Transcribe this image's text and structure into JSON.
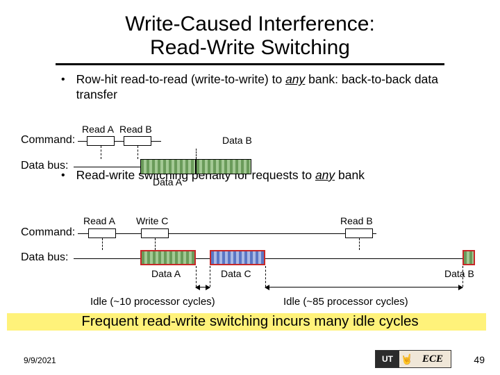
{
  "title_line1": "Write-Caused Interference:",
  "title_line2": "Read-Write Switching",
  "bullets": {
    "b1_pre": "Row-hit read-to-read (write-to-write) to ",
    "b1_em": "any",
    "b1_post": " bank: back-to-back data transfer",
    "b2_pre": "Read-write switching penalty for requests to ",
    "b2_em": "any",
    "b2_post": " bank"
  },
  "labels": {
    "command": "Command:",
    "databus": "Data bus:",
    "read_a": "Read A",
    "read_b": "Read B",
    "write_c": "Write C",
    "data_a": "Data A",
    "data_b": "Data B",
    "data_c": "Data C",
    "idle10": "Idle (~10 processor cycles)",
    "idle85": "Idle (~85 processor cycles)"
  },
  "conclusion": "Frequent read-write switching incurs many idle cycles",
  "footer": {
    "date": "9/9/2021",
    "page": "49",
    "logo_ut": "UT",
    "logo_ece": "ECE"
  },
  "chart_data": [
    {
      "type": "timing",
      "name": "back-to-back-reads",
      "commands": [
        "Read A",
        "Read B"
      ],
      "bus": [
        {
          "label": "Data A",
          "start_rel": 0,
          "len_rel": 1.0,
          "color": "green"
        },
        {
          "label": "Data B",
          "start_rel": 1.0,
          "len_rel": 1.0,
          "color": "green"
        }
      ],
      "idle_cycles": 0
    },
    {
      "type": "timing",
      "name": "read-write-switch",
      "commands": [
        "Read A",
        "Write C",
        "Read B"
      ],
      "bus": [
        {
          "label": "Data A",
          "start_rel": 0,
          "len_rel": 1.0,
          "color": "green",
          "highlighted": true
        },
        {
          "label": "Data C",
          "start_rel": 1.25,
          "len_rel": 1.0,
          "color": "blue",
          "highlighted": true
        },
        {
          "label": "Data B",
          "start_rel": 6.0,
          "len_rel": 0.2,
          "color": "green",
          "highlighted": true
        }
      ],
      "idle_segments": [
        {
          "after": "Data A",
          "approx_processor_cycles": 10
        },
        {
          "after": "Data C",
          "approx_processor_cycles": 85
        }
      ]
    }
  ]
}
